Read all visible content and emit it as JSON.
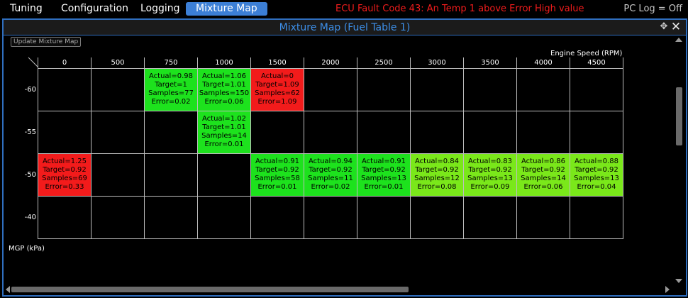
{
  "menu": [
    "Tuning",
    "Configuration",
    "Logging",
    "Mixture Map"
  ],
  "fault_text": "ECU Fault Code 43: An Temp 1 above Error High value",
  "pc_log": "PC Log = Off",
  "window": {
    "title": "Mixture Map (Fuel Table 1)"
  },
  "update_button": "Update Mixture Map",
  "x_axis_label": "Engine Speed (RPM)",
  "y_axis_label": "MGP (kPa)",
  "rpm": [
    "0",
    "500",
    "750",
    "1000",
    "1500",
    "2000",
    "2500",
    "3000",
    "3500",
    "4000",
    "4500"
  ],
  "mgp": [
    "-60",
    "-55",
    "-50",
    "-40"
  ],
  "colors": {
    "red": "#f21b1b",
    "green": "#1de21d",
    "lime": "#7ae81a",
    "accent": "#2f6ebe",
    "fault": "#f01c1c"
  },
  "cells": [
    [
      null,
      null,
      {
        "status": "green",
        "lines": [
          "Actual=0.98",
          "Target=1",
          "Samples=77",
          "Error=0.02"
        ]
      },
      {
        "status": "green",
        "lines": [
          "Actual=1.06",
          "Target=1.01",
          "Samples=150",
          "Error=0.06"
        ]
      },
      {
        "status": "red",
        "lines": [
          "Actual=0",
          "Target=1.09",
          "Samples=62",
          "Error=1.09"
        ]
      },
      null,
      null,
      null,
      null,
      null,
      null
    ],
    [
      null,
      null,
      null,
      {
        "status": "green",
        "lines": [
          "Actual=1.02",
          "Target=1.01",
          "Samples=14",
          "Error=0.01"
        ]
      },
      null,
      null,
      null,
      null,
      null,
      null,
      null
    ],
    [
      {
        "status": "red",
        "lines": [
          "Actual=1.25",
          "Target=0.92",
          "Samples=69",
          "Error=0.33"
        ]
      },
      null,
      null,
      null,
      {
        "status": "green",
        "lines": [
          "Actual=0.91",
          "Target=0.92",
          "Samples=58",
          "Error=0.01"
        ]
      },
      {
        "status": "green",
        "lines": [
          "Actual=0.94",
          "Target=0.92",
          "Samples=11",
          "Error=0.02"
        ]
      },
      {
        "status": "green",
        "lines": [
          "Actual=0.91",
          "Target=0.92",
          "Samples=13",
          "Error=0.01"
        ]
      },
      {
        "status": "lime",
        "lines": [
          "Actual=0.84",
          "Target=0.92",
          "Samples=12",
          "Error=0.08"
        ]
      },
      {
        "status": "lime",
        "lines": [
          "Actual=0.83",
          "Target=0.92",
          "Samples=13",
          "Error=0.09"
        ]
      },
      {
        "status": "lime",
        "lines": [
          "Actual=0.86",
          "Target=0.92",
          "Samples=14",
          "Error=0.06"
        ]
      },
      {
        "status": "lime",
        "lines": [
          "Actual=0.88",
          "Target=0.92",
          "Samples=13",
          "Error=0.04"
        ]
      }
    ],
    [
      null,
      null,
      null,
      null,
      null,
      null,
      null,
      null,
      null,
      null,
      null
    ]
  ]
}
